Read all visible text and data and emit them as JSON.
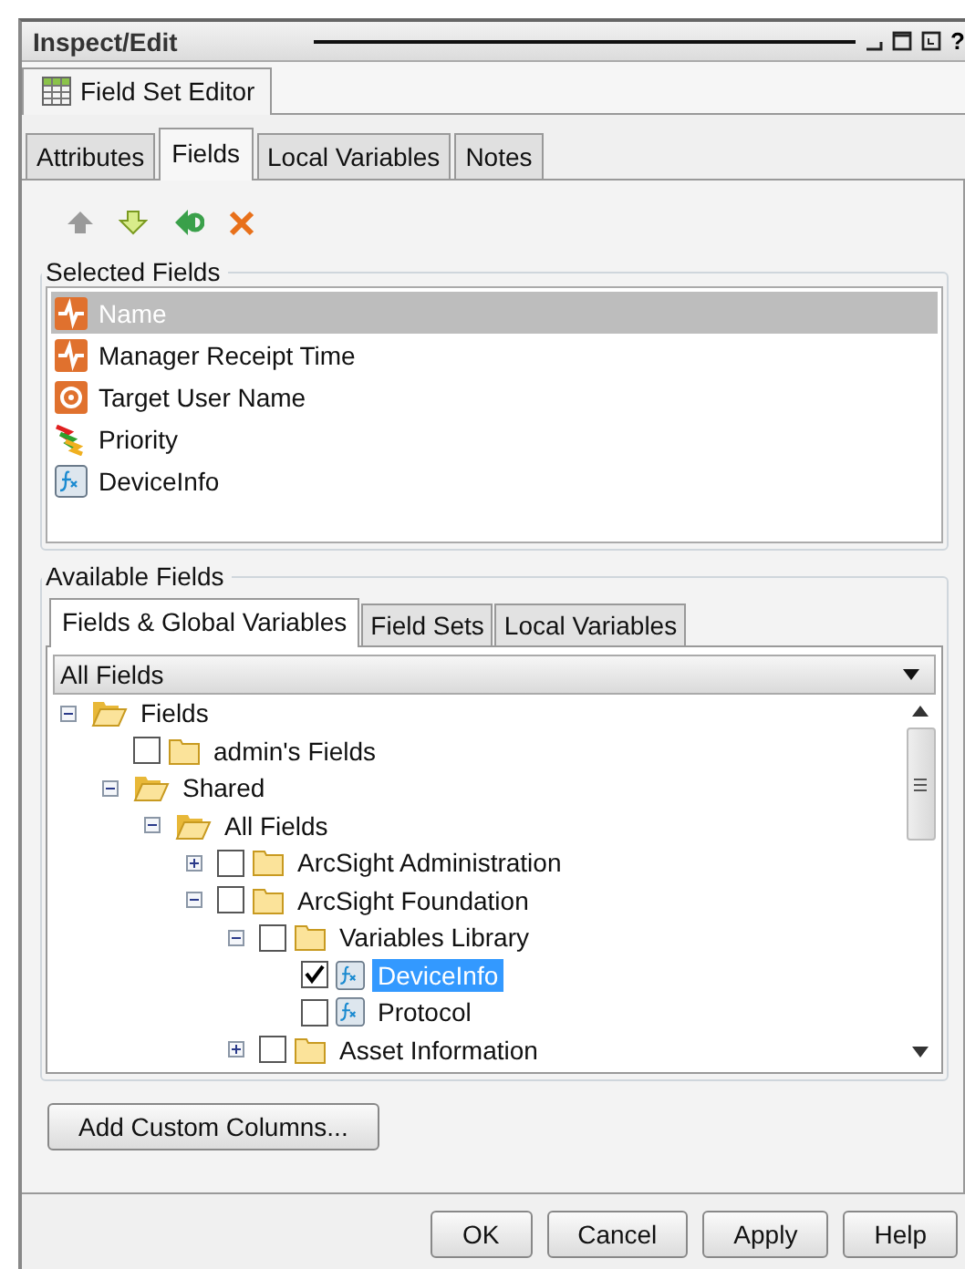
{
  "window": {
    "title": "Inspect/Edit",
    "controls": [
      "?"
    ]
  },
  "editor_tab": {
    "label": "Field Set Editor"
  },
  "tabs": [
    {
      "label": "Attributes",
      "selected": false
    },
    {
      "label": "Fields",
      "selected": true
    },
    {
      "label": "Local Variables",
      "selected": false
    },
    {
      "label": "Notes",
      "selected": false
    }
  ],
  "toolbar": [
    {
      "kind": "up",
      "disabled": true
    },
    {
      "kind": "down",
      "disabled": false
    },
    {
      "kind": "add",
      "disabled": false
    },
    {
      "kind": "delete",
      "disabled": false
    }
  ],
  "selected_fields": {
    "title": "Selected Fields",
    "items": [
      {
        "label": "Name",
        "kind": "event",
        "selected": true
      },
      {
        "label": "Manager Receipt Time",
        "kind": "event",
        "selected": false
      },
      {
        "label": "Target User Name",
        "kind": "target",
        "selected": false
      },
      {
        "label": "Priority",
        "kind": "priority",
        "selected": false
      },
      {
        "label": "DeviceInfo",
        "kind": "function",
        "selected": false
      }
    ]
  },
  "available_fields": {
    "title": "Available Fields",
    "tabs": [
      {
        "label": "Fields & Global Variables",
        "selected": true
      },
      {
        "label": "Field Sets",
        "selected": false
      },
      {
        "label": "Local Variables",
        "selected": false
      }
    ],
    "dropdown": {
      "value": "All Fields"
    },
    "tree": [
      {
        "label": "Fields",
        "kind": "open-folder",
        "expanded": true,
        "selected": false,
        "children": [
          {
            "label": "admin's Fields",
            "kind": "folder",
            "checked": false,
            "selected": false
          },
          {
            "label": "Shared",
            "kind": "open-folder",
            "expanded": true,
            "selected": false,
            "children": [
              {
                "label": "All Fields",
                "kind": "open-folder",
                "expanded": true,
                "selected": false,
                "children": [
                  {
                    "label": "ArcSight Administration",
                    "kind": "folder",
                    "expanded": false,
                    "checked": false,
                    "selected": false
                  },
                  {
                    "label": "ArcSight Foundation",
                    "kind": "folder",
                    "expanded": true,
                    "checked": false,
                    "selected": false,
                    "children": [
                      {
                        "label": "Variables Library",
                        "kind": "folder",
                        "expanded": true,
                        "checked": false,
                        "selected": false,
                        "children": [
                          {
                            "label": "DeviceInfo",
                            "kind": "function",
                            "checked": true,
                            "selected": true
                          },
                          {
                            "label": "Protocol",
                            "kind": "function",
                            "checked": false,
                            "selected": false
                          }
                        ]
                      },
                      {
                        "label": "Asset Information",
                        "kind": "folder",
                        "expanded": false,
                        "checked": false,
                        "selected": false
                      }
                    ]
                  }
                ]
              }
            ]
          }
        ]
      }
    ]
  },
  "custom_columns_button": "Add Custom Columns...",
  "buttons": [
    "OK",
    "Cancel",
    "Apply",
    "Help"
  ]
}
